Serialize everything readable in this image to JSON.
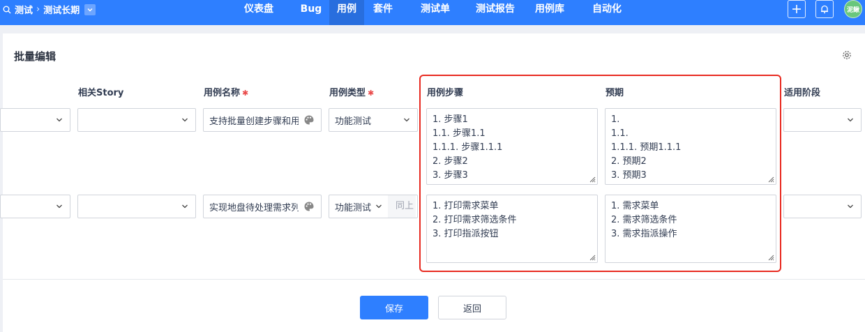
{
  "breadcrumb": {
    "product": "测试",
    "project": "测试长期"
  },
  "nav": {
    "items": [
      "仪表盘",
      "Bug",
      "用例",
      "套件",
      "测试单",
      "测试报告",
      "用例库",
      "自动化"
    ],
    "active": "用例"
  },
  "user": {
    "avatar_text": "泥鳅"
  },
  "panel": {
    "title": "批量编辑"
  },
  "columns": {
    "story": "相关Story",
    "title": "用例名称",
    "type": "用例类型",
    "steps": "用例步骤",
    "expects": "预期",
    "stage": "适用阶段"
  },
  "rows": [
    {
      "module": "",
      "story": "",
      "title": "支持批量创建步骤和用",
      "type": "功能测试",
      "type_suffix": "",
      "steps": [
        "1. 步骤1",
        "1.1. 步骤1.1",
        "1.1.1. 步骤1.1.1",
        "2. 步骤2",
        "3. 步骤3"
      ],
      "expects": [
        "1.",
        "1.1.",
        "1.1.1. 预期1.1.1",
        "2. 预期2",
        "3. 预期3"
      ],
      "stage": ""
    },
    {
      "module": "",
      "story": "",
      "title": "实现地盘待处理需求列",
      "type": "功能测试",
      "type_suffix": "同上",
      "steps": [
        "1. 打印需求菜单",
        "2. 打印需求筛选条件",
        "3. 打印指派按钮"
      ],
      "expects": [
        "1. 需求菜单",
        "2. 需求筛选条件",
        "3. 需求指派操作"
      ],
      "stage": ""
    }
  ],
  "buttons": {
    "save": "保存",
    "back": "返回"
  },
  "colors": {
    "brand": "#2e7fff",
    "highlight": "#e8291f",
    "required": "#e94a4a"
  }
}
